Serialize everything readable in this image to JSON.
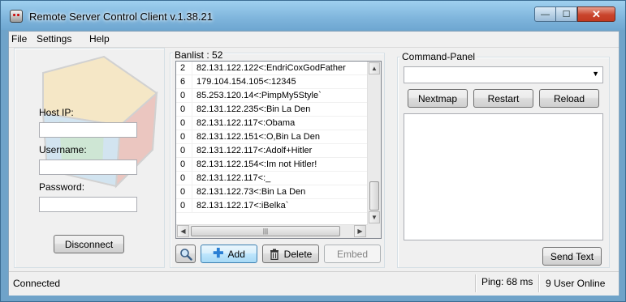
{
  "window": {
    "title": "Remote Server Control Client v.1.38.21",
    "min_glyph": "—",
    "max_glyph": "☐",
    "close_glyph": "✕"
  },
  "menu": {
    "items": [
      "File",
      "Settings",
      "Help"
    ]
  },
  "login": {
    "host_label": "Host IP:",
    "host_value": "",
    "username_label": "Username:",
    "username_value": "",
    "password_label": "Password:",
    "password_value": "",
    "disconnect_label": "Disconnect"
  },
  "banlist": {
    "title": "Banlist : 52",
    "rows": [
      {
        "count": "2",
        "entry": "82.131.122.122<:EndriCoxGodFather"
      },
      {
        "count": "6",
        "entry": "179.104.154.105<:12345"
      },
      {
        "count": "0",
        "entry": "85.253.120.14<:PimpMy5Style`"
      },
      {
        "count": "0",
        "entry": "82.131.122.235<:Bin La Den"
      },
      {
        "count": "0",
        "entry": "82.131.122.117<:Obama"
      },
      {
        "count": "0",
        "entry": "82.131.122.151<:O,Bin La Den"
      },
      {
        "count": "0",
        "entry": "82.131.122.117<:Adolf+Hitler"
      },
      {
        "count": "0",
        "entry": "82.131.122.154<:Im not Hitler!"
      },
      {
        "count": "0",
        "entry": "82.131.122.117<:_"
      },
      {
        "count": "0",
        "entry": "82.131.122.73<:Bin La Den"
      },
      {
        "count": "0",
        "entry": "82.131.122.17<:iBelka`"
      }
    ],
    "search_icon": "magnifier-icon",
    "add_label": "Add",
    "delete_label": "Delete",
    "embed_label": "Embed",
    "hscroll_grip": "|||"
  },
  "command_panel": {
    "title": "Command-Panel",
    "select_value": "",
    "nextmap_label": "Nextmap",
    "restart_label": "Restart",
    "reload_label": "Reload",
    "output_text": "",
    "send_label": "Send Text"
  },
  "status": {
    "connection": "Connected",
    "ping": "Ping: 68 ms",
    "users": "9 User Online"
  },
  "colors": {
    "titlebar": "#7fb5dc",
    "close_button": "#c9442c",
    "client_bg": "#f0f0f0",
    "add_plus": "#2a7fd4"
  }
}
